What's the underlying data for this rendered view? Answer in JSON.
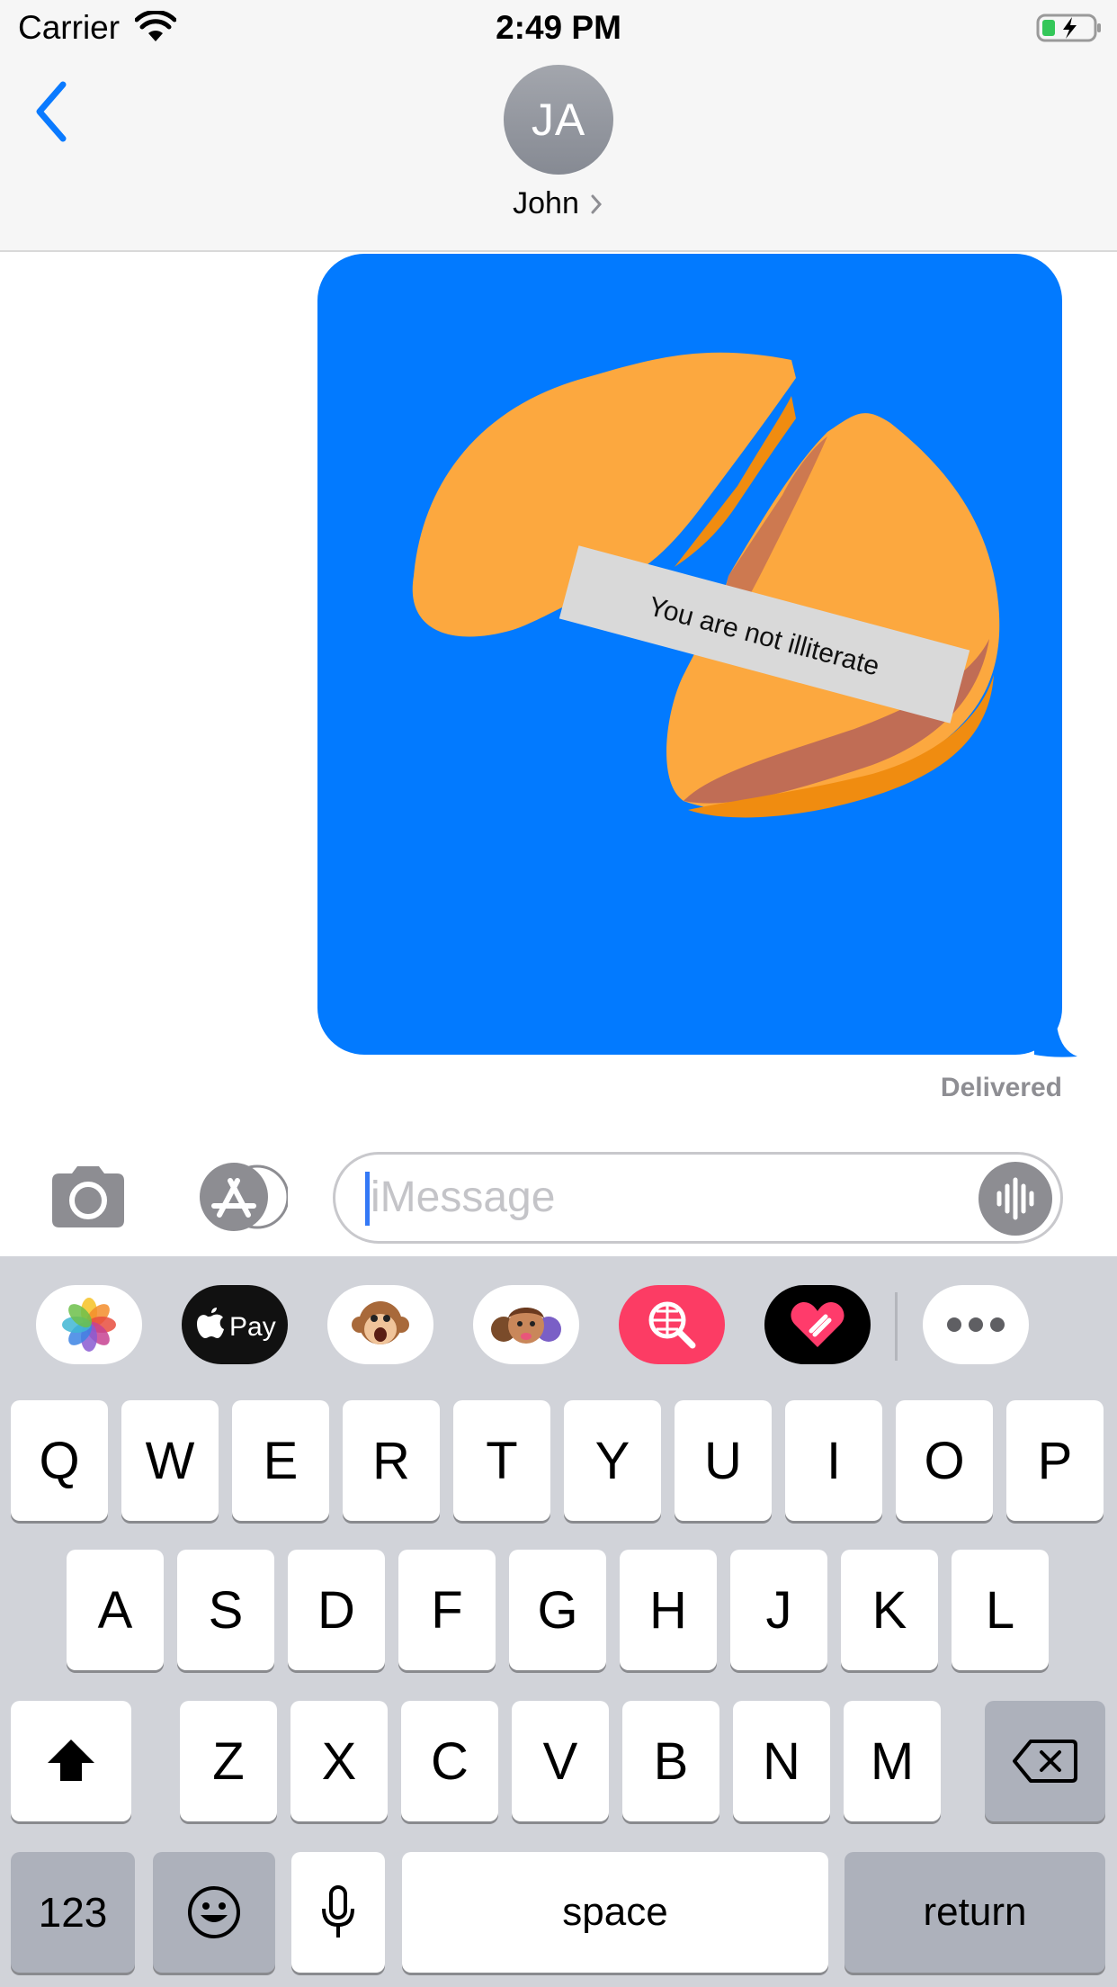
{
  "status_bar": {
    "carrier": "Carrier",
    "time": "2:49 PM",
    "icons": [
      "wifi-icon",
      "battery-charging-icon"
    ]
  },
  "header": {
    "avatar_initials": "JA",
    "contact_name": "John",
    "back_icon": "chevron-left-icon"
  },
  "conversation": {
    "message_sticker": {
      "fortune_text": "You are not illiterate",
      "bubble_color": "#027aff",
      "cookie_color": "#fca83f"
    },
    "status": "Delivered"
  },
  "input_bar": {
    "placeholder": "iMessage",
    "icons": [
      "camera-icon",
      "app-store-icon",
      "audio-waveform-icon"
    ]
  },
  "app_drawer": [
    "photos-app",
    "apple-pay-app",
    "animoji-app",
    "memoji-app",
    "search-gif-app",
    "digital-touch-app",
    "more-apps"
  ],
  "keyboard": {
    "row1": [
      "Q",
      "W",
      "E",
      "R",
      "T",
      "Y",
      "U",
      "I",
      "O",
      "P"
    ],
    "row2": [
      "A",
      "S",
      "D",
      "F",
      "G",
      "H",
      "J",
      "K",
      "L"
    ],
    "row3": [
      "Z",
      "X",
      "C",
      "V",
      "B",
      "N",
      "M"
    ],
    "numbers_label": "123",
    "space_label": "space",
    "return_label": "return"
  }
}
